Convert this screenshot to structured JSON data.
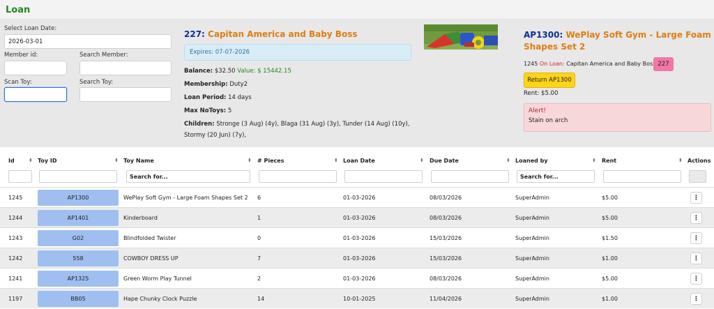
{
  "page": {
    "title": "Loan"
  },
  "form": {
    "loan_date_label": "Select Loan Date:",
    "loan_date_value": "2026-03-01",
    "member_id_label": "Member id:",
    "member_id_value": "",
    "search_member_label": "Search Member:",
    "search_member_value": "",
    "scan_toy_label": "Scan Toy:",
    "scan_toy_value": "",
    "search_toy_label": "Search Toy:",
    "search_toy_value": ""
  },
  "member": {
    "id_label": "227:",
    "name": "Capitan America and Baby Boss",
    "expires": "Expires: 07-07-2026",
    "balance_label": "Balance:",
    "balance_value": "$32.50",
    "value_text": "Value: $ 15442.15",
    "membership_label": "Membership:",
    "membership_value": "Duty2",
    "loan_period_label": "Loan Period:",
    "loan_period_value": "14 days",
    "max_toys_label": "Max NoToys:",
    "max_toys_value": "5",
    "children_label": "Children:",
    "children_line1": "Stronge (3 Aug) (4y), Blaga (31 Aug) (3y), Tunder (14 Aug) (10y),",
    "children_line2": "Stormy (20 Jun) (7y),"
  },
  "toy": {
    "id_label": "AP1300:",
    "name": "WePlay Soft Gym - Large Foam Shapes Set 2",
    "loan_no": "1245",
    "on_loan_label": "On Loan:",
    "on_loan_member": "Capitan America and Baby Boss:",
    "member_badge": "227",
    "return_button": "Return AP1300",
    "rent": "Rent: $5.00",
    "alert_title": "Alert!",
    "alert_text": "Stain on arch"
  },
  "table": {
    "headers": [
      "Id",
      "Toy ID",
      "Toy Name",
      "# Pieces",
      "Loan Date",
      "Due Date",
      "Loaned by",
      "Rent",
      "Actions"
    ],
    "filters": {
      "toy_name_placeholder": "Search for...",
      "loaned_by_placeholder": "Search for..."
    },
    "action_glyph": "⋮",
    "rows": [
      {
        "id": "1245",
        "toy_id": "AP1300",
        "toy_name": "WePlay Soft Gym - Large Foam Shapes Set 2",
        "pieces": "6",
        "loan_date": "01-03-2026",
        "due_date": "08/03/2026",
        "loaned_by": "SuperAdmin",
        "rent": "$5.00"
      },
      {
        "id": "1244",
        "toy_id": "AP1401",
        "toy_name": "Kinderboard",
        "pieces": "1",
        "loan_date": "01-03-2026",
        "due_date": "08/03/2026",
        "loaned_by": "SuperAdmin",
        "rent": "$5.00"
      },
      {
        "id": "1243",
        "toy_id": "G02",
        "toy_name": "Blindfolded Twister",
        "pieces": "0",
        "loan_date": "01-03-2026",
        "due_date": "15/03/2026",
        "loaned_by": "SuperAdmin",
        "rent": "$1.50"
      },
      {
        "id": "1242",
        "toy_id": "558",
        "toy_name": "COWBOY DRESS UP",
        "pieces": "7",
        "loan_date": "01-03-2026",
        "due_date": "15/03/2026",
        "loaned_by": "SuperAdmin",
        "rent": "$1.00"
      },
      {
        "id": "1241",
        "toy_id": "AP1325",
        "toy_name": "Green Worm Play Tunnel",
        "pieces": "2",
        "loan_date": "01-03-2026",
        "due_date": "08/03/2026",
        "loaned_by": "SuperAdmin",
        "rent": "$5.00"
      },
      {
        "id": "1197",
        "toy_id": "BB05",
        "toy_name": "Hape Chunky Clock Puzzle",
        "pieces": "14",
        "loan_date": "10-01-2025",
        "due_date": "11/04/2026",
        "loaned_by": "SuperAdmin",
        "rent": "$1.00"
      }
    ]
  },
  "colors": {
    "title_green": "#1e8a1e",
    "accent_orange": "#e07d10",
    "id_navy": "#0b2f99",
    "toy_chip_blue": "#9fbff0",
    "badge_pink": "#f277a8",
    "return_yellow": "#ffd31a",
    "alert_red": "#b21f2d"
  }
}
